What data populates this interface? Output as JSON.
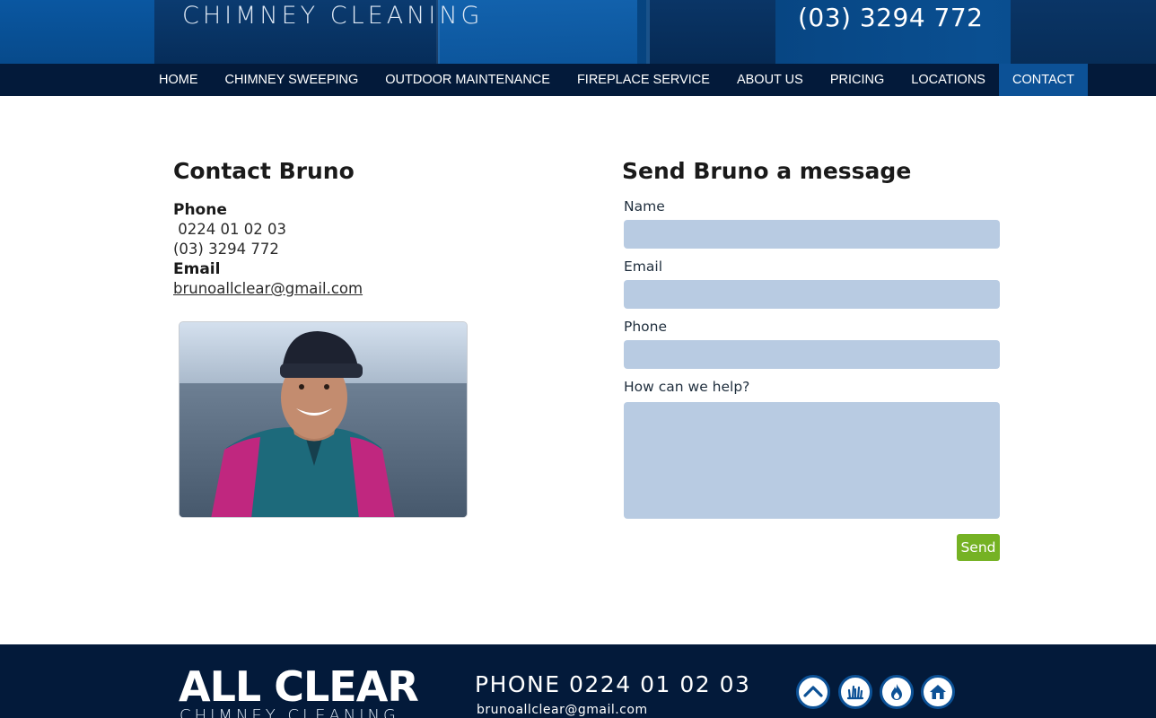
{
  "header": {
    "subtitle": "CHIMNEY CLEANING",
    "phone": "(03) 3294 772"
  },
  "nav": {
    "items": [
      {
        "label": "HOME"
      },
      {
        "label": "CHIMNEY SWEEPING"
      },
      {
        "label": "OUTDOOR MAINTENANCE"
      },
      {
        "label": "FIREPLACE SERVICE"
      },
      {
        "label": "ABOUT US"
      },
      {
        "label": "PRICING"
      },
      {
        "label": "LOCATIONS"
      },
      {
        "label": "CONTACT",
        "active": true
      }
    ]
  },
  "contact": {
    "heading": "Contact Bruno",
    "phone_label": "Phone",
    "phone_1": " 0224 01 02 03",
    "phone_2": "(03) 3294 772",
    "email_label": "Email",
    "email": "brunoallclear@gmail.com"
  },
  "form": {
    "heading": "Send Bruno a message",
    "name_label": "Name",
    "email_label": "Email",
    "phone_label": "Phone",
    "help_label": "How can we help?",
    "send_label": "Send"
  },
  "footer": {
    "logo": "ALL CLEAR",
    "logo_sub": "CHIMNEY CLEANING",
    "phone": "PHONE 0224 01 02 03",
    "email": "brunoallclear@gmail.com",
    "icons": [
      "roof-chevron-icon",
      "grass-icon",
      "flame-icon",
      "house-icon"
    ]
  },
  "colors": {
    "nav_bg": "#031a3a",
    "nav_active": "#0c5196",
    "field_bg": "#b8cbe2",
    "send_button": "#75b224",
    "footer_bg": "#031a3a"
  }
}
